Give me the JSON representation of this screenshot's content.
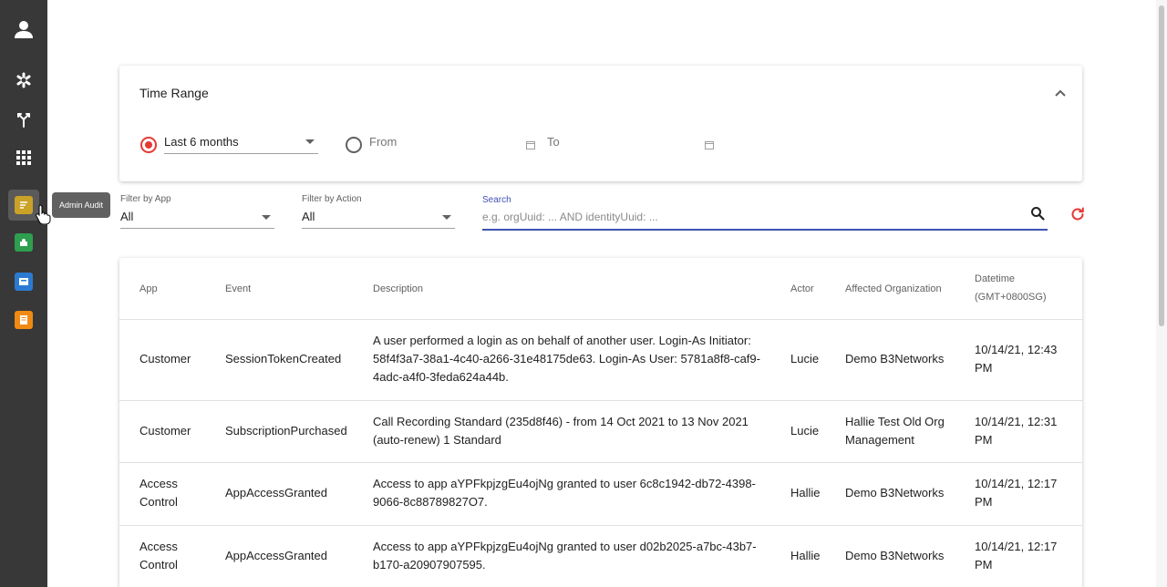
{
  "sidebar": {
    "items": [
      {
        "name": "profile-icon"
      },
      {
        "name": "settings-cog-icon"
      },
      {
        "name": "routing-icon"
      },
      {
        "name": "apps-grid-icon"
      },
      {
        "name": "admin-audit-app-icon",
        "active": true
      },
      {
        "name": "green-app-icon"
      },
      {
        "name": "blue-app-icon"
      },
      {
        "name": "orange-app-icon"
      }
    ],
    "tooltip": "Admin Audit"
  },
  "time_range": {
    "title": "Time Range",
    "preset_value": "Last 6 months",
    "from_label": "From",
    "to_label": "To"
  },
  "filters": {
    "app_label": "Filter by App",
    "app_value": "All",
    "action_label": "Filter by Action",
    "action_value": "All",
    "search_label": "Search",
    "search_placeholder": "e.g. orgUuid: ... AND identityUuid: ..."
  },
  "table": {
    "headers": {
      "app": "App",
      "event": "Event",
      "description": "Description",
      "actor": "Actor",
      "org": "Affected Organization",
      "datetime": "Datetime",
      "tz": "(GMT+0800SG)"
    },
    "rows": [
      {
        "app": "Customer",
        "event": "SessionTokenCreated",
        "description": "A user performed a login as on behalf of another user. Login-As Initiator: 58f4f3a7-38a1-4c40-a266-31e48175de63. Login-As User: 5781a8f8-caf9-4adc-a4f0-3feda624a44b.",
        "actor": "Lucie",
        "org": "Demo B3Networks",
        "datetime": "10/14/21, 12:43 PM"
      },
      {
        "app": "Customer",
        "event": "SubscriptionPurchased",
        "description": "Call Recording Standard (235d8f46) - from 14 Oct 2021 to 13 Nov 2021 (auto-renew) 1 Standard",
        "actor": "Lucie",
        "org": "Hallie Test Old Org Management",
        "datetime": "10/14/21, 12:31 PM"
      },
      {
        "app": "Access Control",
        "event": "AppAccessGranted",
        "description": "Access to app aYPFkpjzgEu4ojNg granted to user 6c8c1942-db72-4398-9066-8c88789827O7.",
        "actor": "Hallie",
        "org": "Demo B3Networks",
        "datetime": "10/14/21, 12:17 PM"
      },
      {
        "app": "Access Control",
        "event": "AppAccessGranted",
        "description": "Access to app aYPFkpjzgEu4ojNg granted to user d02b2025-a7bc-43b7-b170-a20907907595.",
        "actor": "Hallie",
        "org": "Demo B3Networks",
        "datetime": "10/14/21, 12:17 PM"
      }
    ]
  },
  "colors": {
    "sidebar_bg": "#383838",
    "accent_red": "#e53935",
    "accent_indigo": "#3f51b5"
  }
}
